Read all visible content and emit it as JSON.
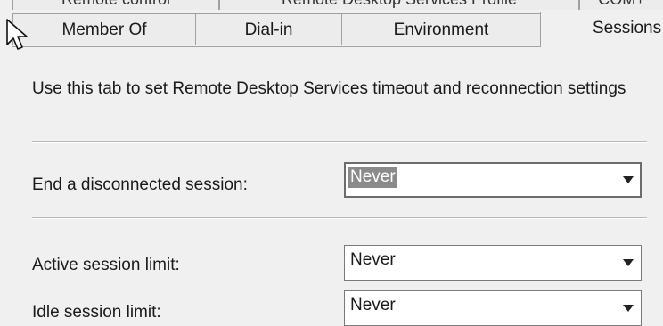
{
  "tabs_back": [
    {
      "label": "Remote control"
    },
    {
      "label": "Remote Desktop Services Profile"
    },
    {
      "label": "COM+"
    }
  ],
  "tabs": [
    {
      "label": "Member Of"
    },
    {
      "label": "Dial-in"
    },
    {
      "label": "Environment"
    },
    {
      "label": "Sessions",
      "selected": true
    }
  ],
  "description": "Use this tab to set Remote Desktop Services timeout and reconnection settings",
  "fields": [
    {
      "label": "End a disconnected session:",
      "value": "Never",
      "focused": true
    },
    {
      "label": "Active session limit:",
      "value": "Never"
    },
    {
      "label": "Idle session limit:",
      "value": "Never"
    }
  ],
  "icons": {
    "cursor": "mouse-pointer-icon",
    "dropdown": "chevron-down-icon"
  },
  "colors": {
    "background": "#f0f0f0",
    "selection": "#8a8a8a",
    "border": "#a0a0a0"
  }
}
